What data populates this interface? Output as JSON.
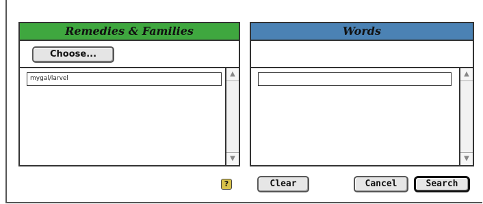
{
  "left_panel": {
    "title": "Remedies & Families",
    "choose_label": "Choose...",
    "list_items": [
      "mygal/larvel"
    ]
  },
  "right_panel": {
    "title": "Words",
    "field_value": ""
  },
  "footer": {
    "help_icon": "?",
    "clear_label": "Clear",
    "cancel_label": "Cancel",
    "search_label": "Search"
  },
  "icons": {
    "scroll_up": "▲",
    "scroll_down": "▼"
  },
  "colors": {
    "remedies_header": "#3fa73f",
    "words_header": "#4b82b4"
  }
}
